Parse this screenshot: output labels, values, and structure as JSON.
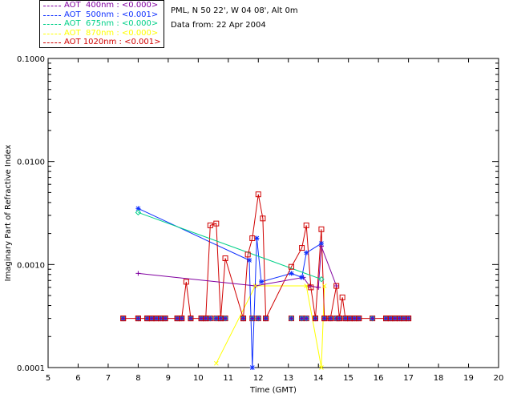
{
  "header": {
    "location": "PML, N 50 22', W 04 08', Alt 0m",
    "date": "Data from: 22 Apr 2004"
  },
  "legend": [
    {
      "label": "AOT  400nm : <0.000>",
      "color": "#8000a0"
    },
    {
      "label": "AOT  500nm : <0.001>",
      "color": "#1030ff"
    },
    {
      "label": "AOT  675nm : <0.000>",
      "color": "#00d088"
    },
    {
      "label": "AOT  870nm : <0.000>",
      "color": "#ffff00"
    },
    {
      "label": "AOT 1020nm : <0.001>",
      "color": "#d00000"
    }
  ],
  "chart_data": {
    "type": "line",
    "xlabel": "Time (GMT)",
    "ylabel": "Imaginary Part of Refractive Index",
    "xlim": [
      5,
      20
    ],
    "ylim": [
      0.0001,
      0.1
    ],
    "yscale": "log",
    "x_ticks": [
      "5",
      "6",
      "7",
      "8",
      "9",
      "10",
      "11",
      "12",
      "13",
      "14",
      "15",
      "16",
      "17",
      "18",
      "19",
      "20"
    ],
    "y_ticks": [
      "0.0001",
      "0.0010",
      "0.0100",
      "0.1000"
    ],
    "series": [
      {
        "name": "AOT  400nm : <0.000>",
        "color": "#8000a0",
        "points": [
          [
            8.0,
            0.00082
          ],
          [
            11.9,
            0.00062
          ],
          [
            13.5,
            0.00075
          ],
          [
            13.7,
            0.00062
          ],
          [
            14.0,
            0.0006
          ],
          [
            14.1,
            0.0015
          ],
          [
            14.6,
            0.00062
          ]
        ]
      },
      {
        "name": "AOT  500nm : <0.001>",
        "color": "#1030ff",
        "points": [
          [
            8.0,
            0.0035
          ],
          [
            11.7,
            0.0011
          ],
          [
            11.8,
            0.0001
          ],
          [
            11.95,
            0.0018
          ],
          [
            12.1,
            0.00068
          ],
          [
            13.1,
            0.00082
          ],
          [
            13.45,
            0.00075
          ],
          [
            13.6,
            0.0013
          ],
          [
            14.1,
            0.0016
          ]
        ]
      },
      {
        "name": "AOT  675nm : <0.000>",
        "color": "#00d088",
        "points": [
          [
            8.0,
            0.0032
          ],
          [
            14.1,
            0.00072
          ]
        ]
      },
      {
        "name": "AOT  870nm : <0.000>",
        "color": "#ffff00",
        "points": [
          [
            10.6,
            0.00011
          ],
          [
            11.9,
            0.00062
          ],
          [
            13.6,
            0.00062
          ],
          [
            14.1,
            0.0001
          ],
          [
            14.2,
            0.00062
          ]
        ]
      },
      {
        "name": "AOT 1020nm : <0.001>",
        "color": "#d00000",
        "points": [
          [
            7.5,
            0.0003
          ],
          [
            8.0,
            0.0003
          ],
          [
            8.3,
            0.0003
          ],
          [
            8.45,
            0.0003
          ],
          [
            8.6,
            0.0003
          ],
          [
            8.75,
            0.0003
          ],
          [
            8.9,
            0.0003
          ],
          [
            9.3,
            0.0003
          ],
          [
            9.45,
            0.0003
          ],
          [
            9.6,
            0.00068
          ],
          [
            9.75,
            0.0003
          ],
          [
            10.1,
            0.0003
          ],
          [
            10.25,
            0.0003
          ],
          [
            10.4,
            0.0024
          ],
          [
            10.6,
            0.0025
          ],
          [
            10.75,
            0.0003
          ],
          [
            10.9,
            0.00115
          ],
          [
            11.5,
            0.0003
          ],
          [
            11.65,
            0.00125
          ],
          [
            11.8,
            0.0018
          ],
          [
            12.0,
            0.0048
          ],
          [
            12.15,
            0.0028
          ],
          [
            12.25,
            0.0003
          ],
          [
            13.1,
            0.00095
          ],
          [
            13.45,
            0.00145
          ],
          [
            13.6,
            0.0024
          ],
          [
            13.75,
            0.0006
          ],
          [
            13.9,
            0.0003
          ],
          [
            14.1,
            0.0022
          ],
          [
            14.2,
            0.0003
          ],
          [
            14.4,
            0.0003
          ],
          [
            14.6,
            0.00062
          ],
          [
            14.7,
            0.0003
          ],
          [
            14.8,
            0.00048
          ],
          [
            14.9,
            0.0003
          ],
          [
            15.05,
            0.0003
          ],
          [
            15.2,
            0.0003
          ],
          [
            15.35,
            0.0003
          ],
          [
            16.25,
            0.0003
          ],
          [
            16.4,
            0.0003
          ],
          [
            16.55,
            0.0003
          ],
          [
            16.7,
            0.0003
          ],
          [
            16.85,
            0.0003
          ],
          [
            17.0,
            0.0003
          ]
        ]
      }
    ],
    "common_level_points": {
      "value": 0.0003,
      "x": [
        7.5,
        8.0,
        8.3,
        8.45,
        8.6,
        8.75,
        8.9,
        9.3,
        9.45,
        9.75,
        10.1,
        10.25,
        10.4,
        10.6,
        10.75,
        10.9,
        11.5,
        11.8,
        12.0,
        12.25,
        13.1,
        13.45,
        13.6,
        13.9,
        14.2,
        14.4,
        14.6,
        14.7,
        14.9,
        15.05,
        15.2,
        15.35,
        15.8,
        16.25,
        16.4,
        16.55,
        16.7,
        16.85,
        17.0
      ]
    }
  }
}
